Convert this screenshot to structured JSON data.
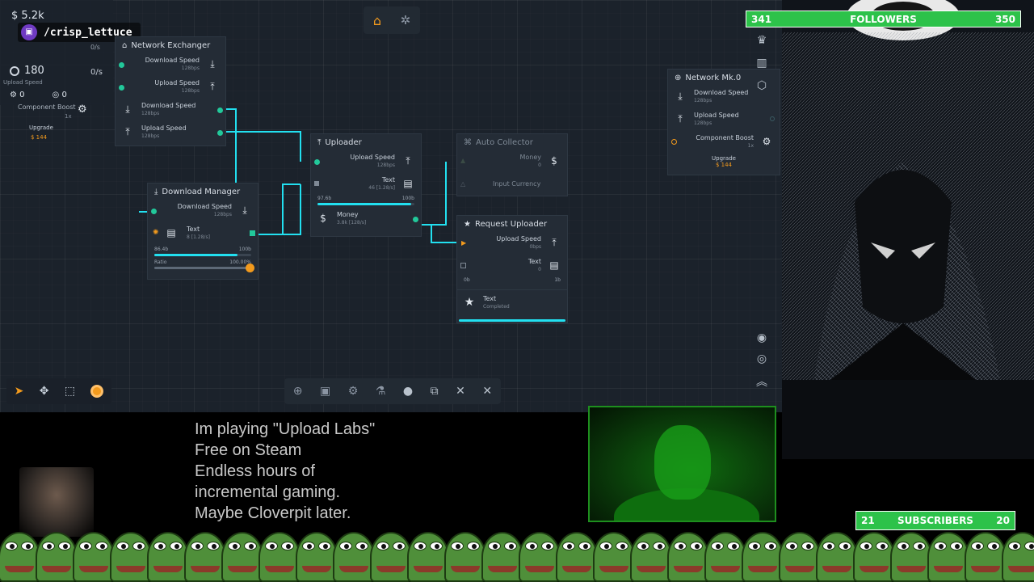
{
  "hud": {
    "money": "$ 5.2k",
    "rate1": "0/s",
    "rate2": "0/s",
    "counter": "180",
    "small1": "0",
    "small2": "0"
  },
  "twitch": {
    "handle": "/crisp_lettuce"
  },
  "nodes": {
    "network_exchanger": {
      "title": "Network Exchanger",
      "rows": [
        {
          "label": "Download Speed",
          "sub": "128bps"
        },
        {
          "label": "Upload Speed",
          "sub": "128bps"
        }
      ],
      "left_rows": [
        {
          "label": "Download Speed",
          "sub": "128bps"
        },
        {
          "label": "Upload Speed",
          "sub": "128bps"
        }
      ],
      "component_boost": "Component Boost",
      "boost_mult": "1x",
      "upgrade": "Upgrade",
      "upgrade_cost": "$ 144",
      "partial_upload": "Upload Speed"
    },
    "download_manager": {
      "title": "Download Manager",
      "row1": {
        "label": "Download Speed",
        "sub": "128bps"
      },
      "row2": {
        "label": "Text",
        "sub": "8 [1.28/s]"
      },
      "bar_left": "86.4b",
      "bar_right": "100b",
      "bar_fill": 0.86,
      "ratio_label": "Ratio",
      "ratio_value": "100.00%",
      "ratio_fill": 1.0
    },
    "uploader": {
      "title": "Uploader",
      "row1": {
        "label": "Upload Speed",
        "sub": "128bps"
      },
      "row2": {
        "label": "Text",
        "sub": "46 [1.28/s]"
      },
      "bar_left": "97.6b",
      "bar_right": "100b",
      "bar_fill": 0.97,
      "money": {
        "label": "Money",
        "sub": "3.8k [128/s]"
      }
    },
    "auto_collector": {
      "title": "Auto Collector",
      "row1": {
        "label": "Money",
        "sub": "0"
      },
      "row2": {
        "label": "Input Currency"
      }
    },
    "request_uploader": {
      "title": "Request Uploader",
      "row1": {
        "label": "Upload Speed",
        "sub": "0bps"
      },
      "row2": {
        "label": "Text",
        "sub": "0"
      },
      "bar_left": "0b",
      "bar_right": "1b",
      "completed": {
        "label": "Text",
        "sub": "Completed"
      }
    },
    "network_mk": {
      "title": "Network Mk.0",
      "rows": [
        {
          "label": "Download Speed",
          "sub": "128bps"
        },
        {
          "label": "Upload Speed",
          "sub": "128bps"
        }
      ],
      "component_boost": "Component Boost",
      "boost_mult": "1x",
      "upgrade": "Upgrade",
      "upgrade_cost": "$ 144"
    }
  },
  "overlay": {
    "lines": [
      "Im playing \"Upload Labs\"",
      "Free on Steam",
      "Endless hours of",
      "incremental gaming.",
      "Maybe Cloverpit later."
    ]
  },
  "followers": {
    "current": "341",
    "label": "FOLLOWERS",
    "goal": "350"
  },
  "subscribers": {
    "current": "21",
    "label": "SUBSCRIBERS",
    "goal": "20"
  },
  "colors": {
    "wire": "#22e0f0",
    "port": "#22c89a",
    "goal_bar": "#2dc24a",
    "accent_orange": "#f29a1d"
  }
}
